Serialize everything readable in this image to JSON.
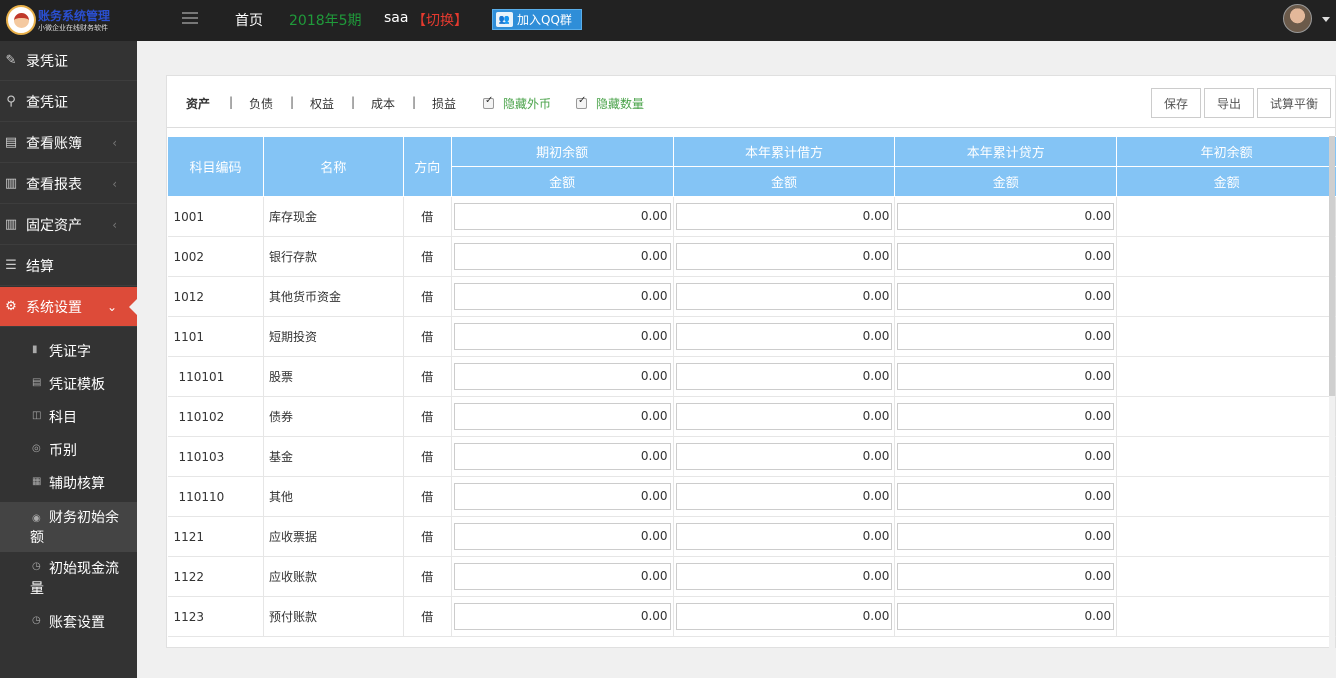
{
  "header": {
    "brand": "账务系统管理",
    "brand_sub": "小微企业在线财务软件",
    "nav_home": "首页",
    "period": "2018年5期",
    "user": "saa",
    "switch": "【切换】",
    "qq_button": "加入QQ群"
  },
  "sidebar": {
    "items": [
      {
        "label": "录凭证",
        "icon": "edit-icon"
      },
      {
        "label": "查凭证",
        "icon": "search-icon"
      },
      {
        "label": "查看账簿",
        "icon": "book-icon"
      },
      {
        "label": "查看报表",
        "icon": "chart-icon"
      },
      {
        "label": "固定资产",
        "icon": "chart-icon"
      },
      {
        "label": "结算",
        "icon": "list-icon"
      },
      {
        "label": "系统设置",
        "icon": "gear-icon"
      }
    ],
    "sub_items": [
      {
        "label": "凭证字",
        "icon": "doc-icon"
      },
      {
        "label": "凭证模板",
        "icon": "doc-icon"
      },
      {
        "label": "科目",
        "icon": "book-icon"
      },
      {
        "label": "币别",
        "icon": "coin-icon"
      },
      {
        "label": "辅助核算",
        "icon": "tag-icon"
      },
      {
        "label": "财务初始余额",
        "icon": "circle-icon"
      },
      {
        "label": "初始现金流量",
        "icon": "clock-icon"
      },
      {
        "label": "账套设置",
        "icon": "clock-icon"
      }
    ]
  },
  "toolbar": {
    "tabs": [
      "资产",
      "负债",
      "权益",
      "成本",
      "损益"
    ],
    "checkboxes": [
      "隐藏外币",
      "隐藏数量"
    ],
    "buttons": [
      "保存",
      "导出",
      "试算平衡"
    ]
  },
  "table": {
    "headers": {
      "code": "科目编码",
      "name": "名称",
      "direction": "方向",
      "groups": [
        "期初余额",
        "本年累计借方",
        "本年累计贷方",
        "年初余额"
      ],
      "sub": "金额"
    },
    "rows": [
      {
        "code": "1001",
        "name": "库存现金",
        "dir": "借",
        "opening": "0.00",
        "debit": "0.00",
        "credit": "0.00"
      },
      {
        "code": "1002",
        "name": "银行存款",
        "dir": "借",
        "opening": "0.00",
        "debit": "0.00",
        "credit": "0.00"
      },
      {
        "code": "1012",
        "name": "其他货币资金",
        "dir": "借",
        "opening": "0.00",
        "debit": "0.00",
        "credit": "0.00"
      },
      {
        "code": "1101",
        "name": "短期投资",
        "dir": "借",
        "opening": "0.00",
        "debit": "0.00",
        "credit": "0.00"
      },
      {
        "code": "110101",
        "name": "股票",
        "dir": "借",
        "opening": "0.00",
        "debit": "0.00",
        "credit": "0.00"
      },
      {
        "code": "110102",
        "name": "债券",
        "dir": "借",
        "opening": "0.00",
        "debit": "0.00",
        "credit": "0.00"
      },
      {
        "code": "110103",
        "name": "基金",
        "dir": "借",
        "opening": "0.00",
        "debit": "0.00",
        "credit": "0.00"
      },
      {
        "code": "110110",
        "name": "其他",
        "dir": "借",
        "opening": "0.00",
        "debit": "0.00",
        "credit": "0.00"
      },
      {
        "code": "1121",
        "name": "应收票据",
        "dir": "借",
        "opening": "0.00",
        "debit": "0.00",
        "credit": "0.00"
      },
      {
        "code": "1122",
        "name": "应收账款",
        "dir": "借",
        "opening": "0.00",
        "debit": "0.00",
        "credit": "0.00"
      },
      {
        "code": "1123",
        "name": "预付账款",
        "dir": "借",
        "opening": "0.00",
        "debit": "0.00",
        "credit": "0.00"
      }
    ]
  }
}
